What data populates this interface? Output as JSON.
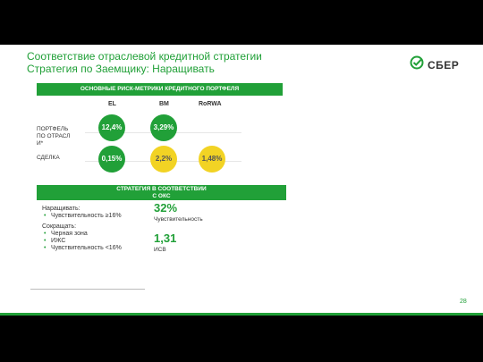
{
  "title": {
    "line1": "Соответствие отраслевой кредитной стратегии",
    "line2": "Стратегия по Заемщику: Наращивать"
  },
  "logo": {
    "text": "СБЕР",
    "icon": "sber-check-icon"
  },
  "metrics_bar": "ОСНОВНЫЕ РИСК-МЕТРИКИ КРЕДИТНОГО ПОРТФЕЛЯ",
  "columns": [
    "EL",
    "BM",
    "RoRWA"
  ],
  "rows": [
    "ПОРТФЕЛЬ ПО ОТРАСЛИ*",
    "СДЕЛКА"
  ],
  "circles": [
    {
      "value": "12,4%",
      "color": "green"
    },
    {
      "value": "3,29%",
      "color": "green"
    },
    {
      "value": "0,15%",
      "color": "green"
    },
    {
      "value": "2,2%",
      "color": "yellow"
    },
    {
      "value": "1,48%",
      "color": "yellow"
    }
  ],
  "strategy_bar": {
    "line1": "СТРАТЕГИЯ В СООТВЕТСТВИИ",
    "line2": "С ОКС"
  },
  "lists": {
    "grow_head": "Наращивать:",
    "grow_items": [
      "Чувствительность ≥16%"
    ],
    "reduce_head": "Сокращать:",
    "reduce_items": [
      "Черная зона",
      "ИЖС",
      "Чувствительность <16%"
    ]
  },
  "stats": [
    {
      "value": "32%",
      "label": "Чувствительность"
    },
    {
      "value": "1,31",
      "label": "ИСВ"
    }
  ],
  "page_number": "28",
  "colors": {
    "accent": "#21a038",
    "yellow": "#f2d324",
    "background": "#000000"
  }
}
